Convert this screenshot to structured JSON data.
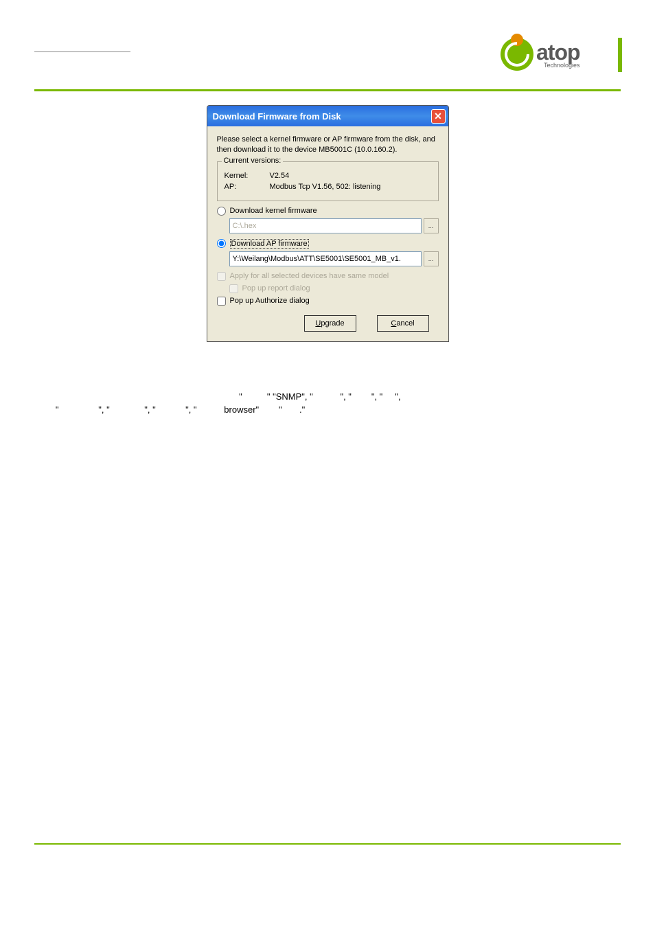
{
  "logo": {
    "name": "atop",
    "sub": "Technologies"
  },
  "dialog": {
    "title": "Download Firmware from Disk",
    "instructions": "Please select a kernel firmware or AP firmware from the disk, and then download it to the device MB5001C (10.0.160.2).",
    "current_versions_legend": "Current versions:",
    "kernel_label": "Kernel:",
    "kernel_value": "V2.54",
    "ap_label": "AP:",
    "ap_value": "Modbus Tcp V1.56, 502: listening",
    "radio_kernel": "Download kernel firmware",
    "radio_ap": "Download AP firmware",
    "kernel_path": "C:\\.hex",
    "ap_path": "Y:\\Weilang\\Modbus\\ATT\\SE5001\\SE5001_MB_v1.",
    "browse": "...",
    "chk_apply_all": "Apply for all selected devices have same model",
    "chk_popup_report": "Pop up report dialog",
    "chk_popup_auth": "Pop up Authorize dialog",
    "btn_upgrade_pre": "U",
    "btn_upgrade_rest": "pgrade",
    "btn_cancel_pre": "C",
    "btn_cancel_rest": "ancel"
  },
  "body_text": {
    "line1_quoted_1": "\"",
    "line1_mid_1": "\" \"SNMP\", \"",
    "line1_mid_2": "\", \"",
    "line1_mid_3": "\", \"",
    "line1_end": "\",",
    "line2_start": "\"",
    "line2_mid_1": "\", \"",
    "line2_mid_2": "\", \"",
    "line2_mid_3": "\", \"",
    "line2_browser": "browser\"",
    "line2_end": "\"",
    "line2_final": ".\""
  }
}
